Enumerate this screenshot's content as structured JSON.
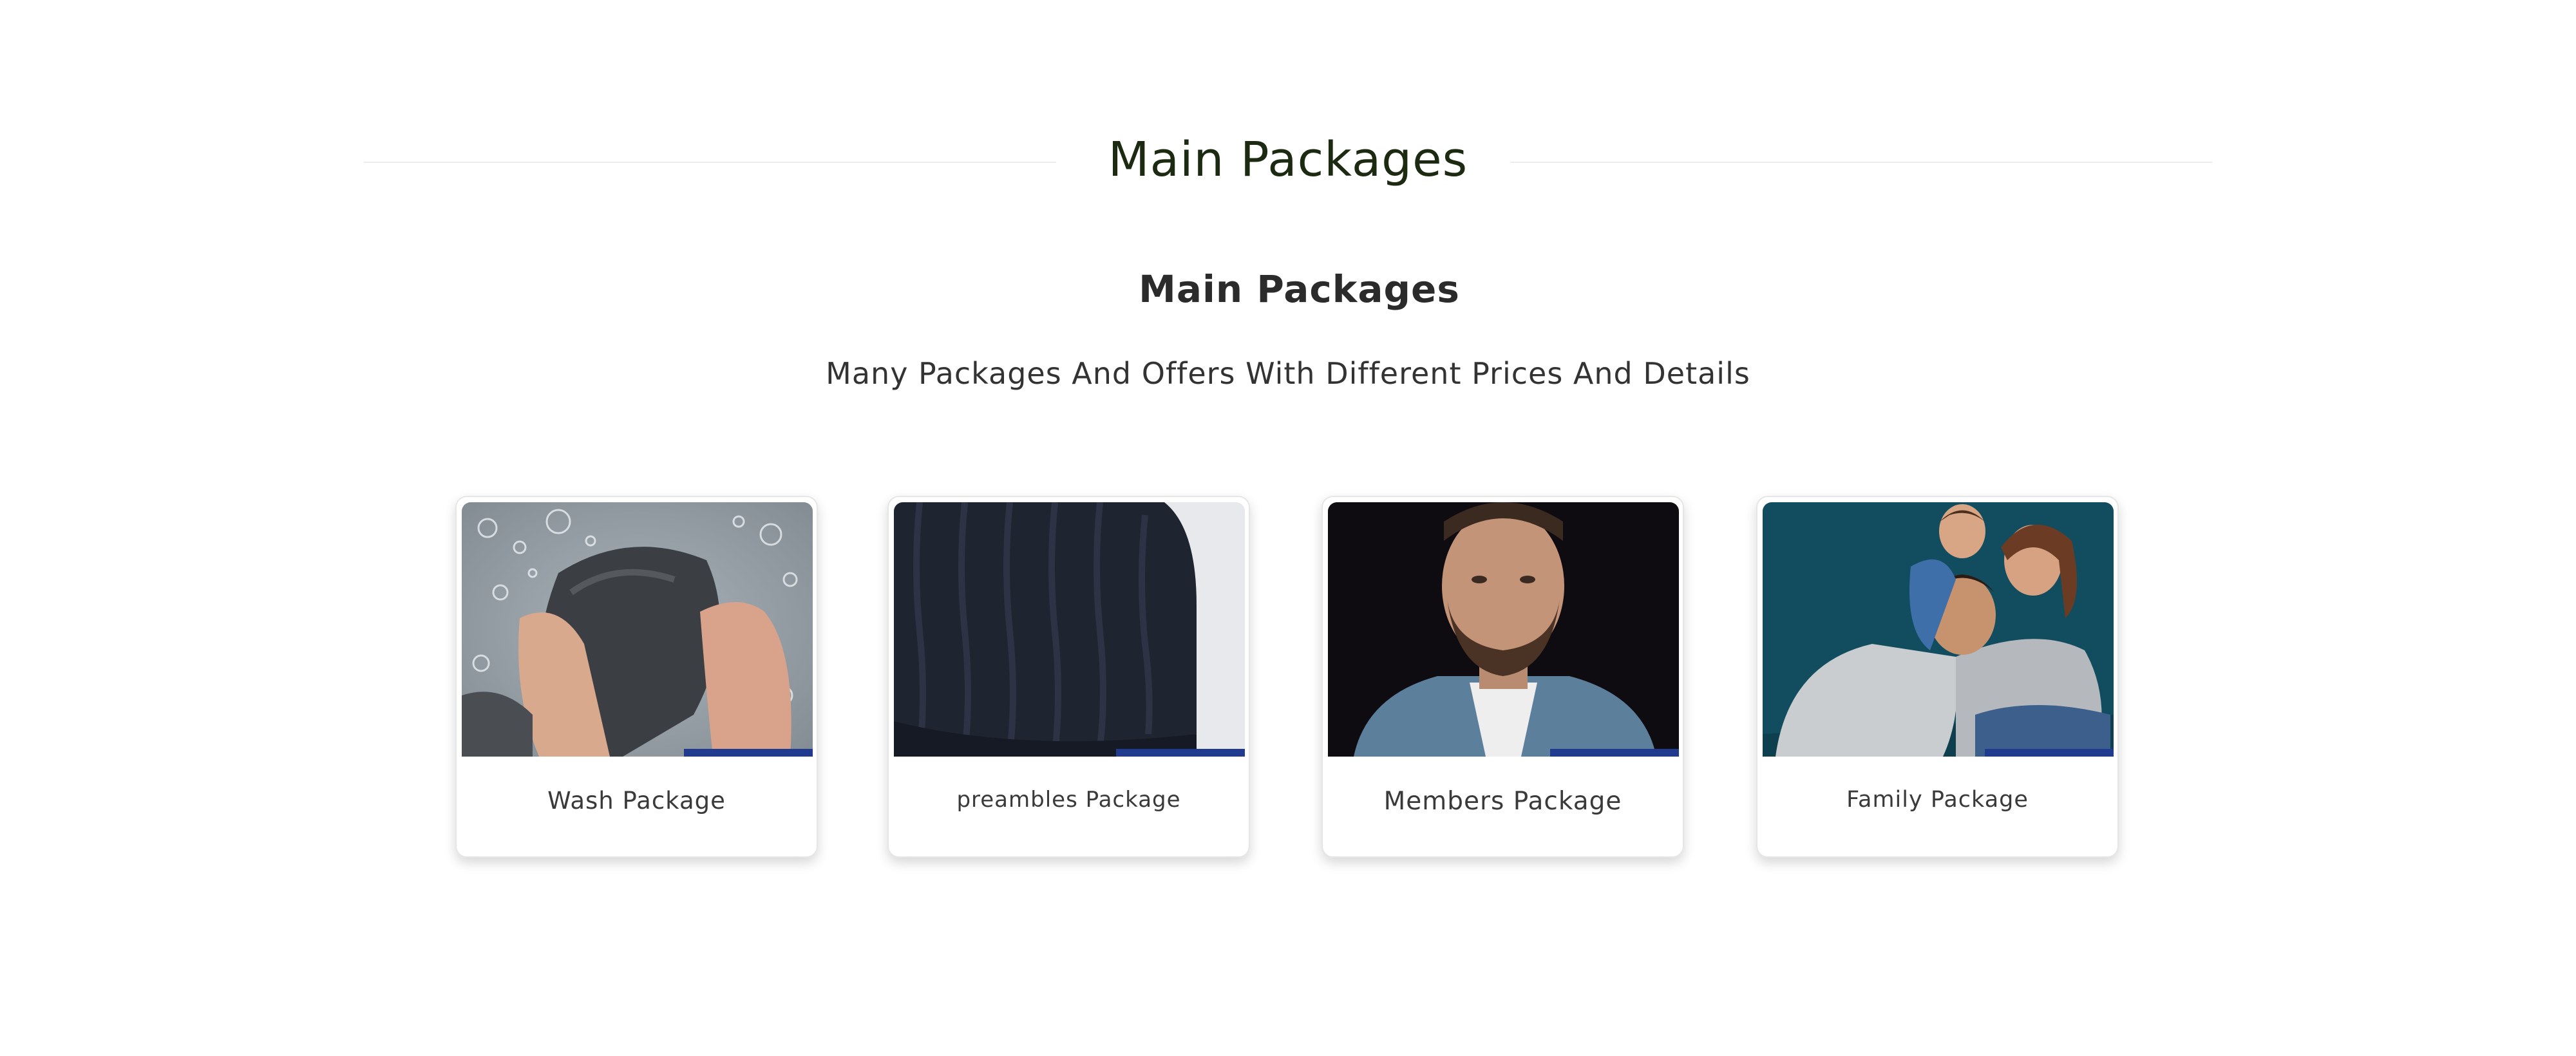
{
  "section": {
    "title": "Main Packages",
    "subtitle": "Main Packages",
    "tagline": "Many Packages And Offers With Different Prices And Details"
  },
  "colors": {
    "title": "#1c2a12",
    "accent": "#1f3a8f",
    "card_border": "#e6e6e6"
  },
  "packages": [
    {
      "label": "Wash Package",
      "image": "hands-washing-fabric-photo"
    },
    {
      "label": "preambles Package",
      "image": "folded-knit-blanket-photo"
    },
    {
      "label": "Members Package",
      "image": "man-portrait-photo"
    },
    {
      "label": "Family Package",
      "image": "family-portrait-photo"
    }
  ]
}
